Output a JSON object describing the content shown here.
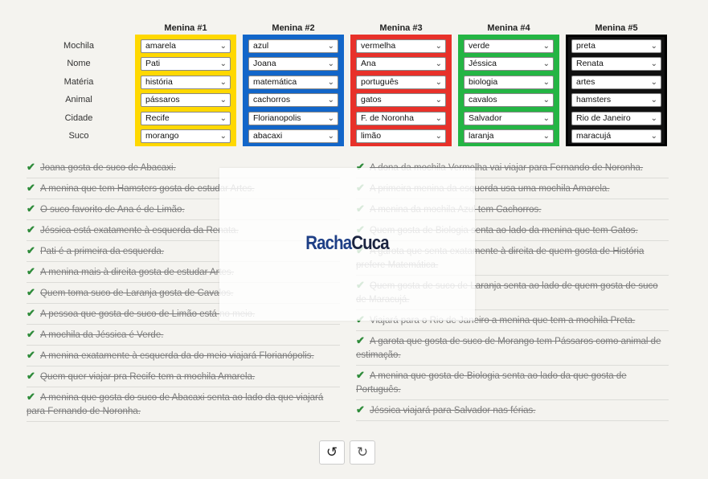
{
  "rows": [
    "Mochila",
    "Nome",
    "Matéria",
    "Animal",
    "Cidade",
    "Suco"
  ],
  "girls": [
    {
      "title": "Menina #1",
      "color": "#ffd800",
      "values": [
        "amarela",
        "Pati",
        "história",
        "pássaros",
        "Recife",
        "morango"
      ]
    },
    {
      "title": "Menina #2",
      "color": "#1266c9",
      "values": [
        "azul",
        "Joana",
        "matemática",
        "cachorros",
        "Florianopolis",
        "abacaxi"
      ]
    },
    {
      "title": "Menina #3",
      "color": "#e8312a",
      "values": [
        "vermelha",
        "Ana",
        "português",
        "gatos",
        "F. de Noronha",
        "limão"
      ]
    },
    {
      "title": "Menina #4",
      "color": "#24b544",
      "values": [
        "verde",
        "Jéssica",
        "biologia",
        "cavalos",
        "Salvador",
        "laranja"
      ]
    },
    {
      "title": "Menina #5",
      "color": "#111111",
      "values": [
        "preta",
        "Renata",
        "artes",
        "hamsters",
        "Rio de Janeiro",
        "maracujá"
      ]
    }
  ],
  "clues_left": [
    "Joana gosta de suco de Abacaxi.",
    "A menina que tem Hamsters gosta de estudar Artes.",
    "O suco favorito de Ana é de Limão.",
    "Jéssica está exatamente à esquerda da Renata.",
    "Pati é a primeira da esquerda.",
    "A menina mais à direita gosta de estudar Artes.",
    "Quem toma suco de Laranja gosta de Cavalos.",
    "A pessoa que gosta de suco de Limão está no meio.",
    "A mochila da Jéssica é Verde.",
    "A menina exatamente à esquerda da do meio viajará Florianópolis.",
    "Quem quer viajar pra Recife tem a mochila Amarela.",
    "A menina que gosta do suco de Abacaxi senta ao lado da que viajará para Fernando de Noronha."
  ],
  "clues_right": [
    "A dona da mochila Vermelha vai viajar para Fernando de Noronha.",
    "A primeira menina da esquerda usa uma mochila Amarela.",
    "A menina da mochila Azul tem Cachorros.",
    "Quem gosta de Biologia senta ao lado da menina que tem Gatos.",
    "A garota que senta exatamente à direita de quem gosta de História prefere Matemática.",
    "Quem gosta de suco de Laranja senta ao lado de quem gosta de suco de Maracujá.",
    "Viajará para o Rio de Janeiro a menina que tem a mochila Preta.",
    "A garota que gosta de suco de Morango tem Pássaros como animal de estimação.",
    "A menina que gosta de Biologia senta ao lado da que gosta de Português.",
    "Jéssica viajará para Salvador nas férias."
  ],
  "logo": "RachaCuca",
  "icons": {
    "check": "check-icon",
    "chevron": "chevron-down-icon",
    "undo": "undo-icon",
    "redo": "redo-icon"
  }
}
